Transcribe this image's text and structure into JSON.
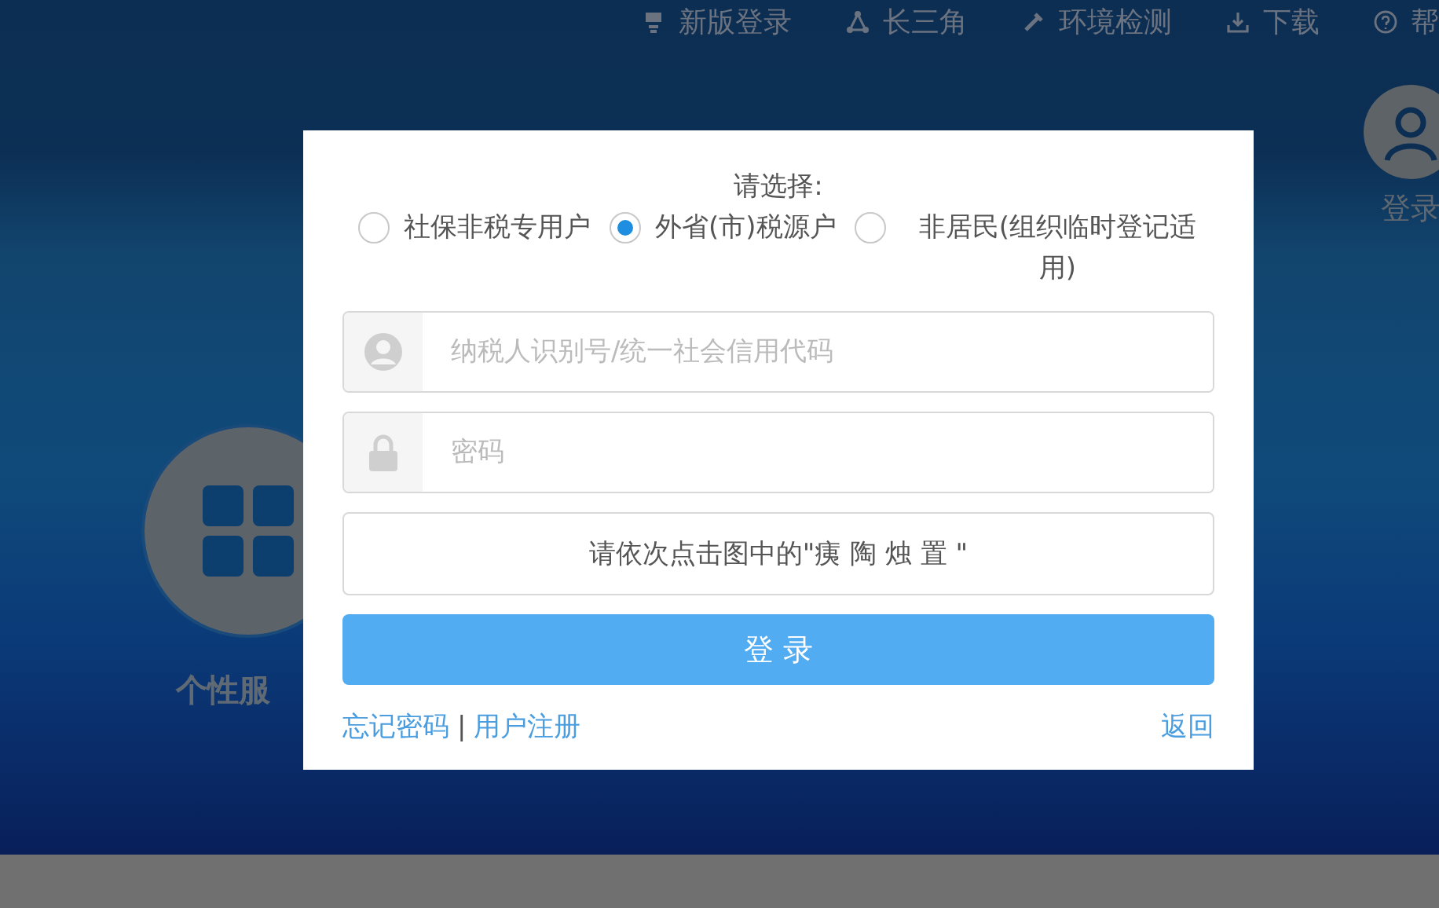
{
  "nav": [
    {
      "label": "新版登录"
    },
    {
      "label": "长三角"
    },
    {
      "label": "环境检测"
    },
    {
      "label": "下载"
    },
    {
      "label": "帮"
    }
  ],
  "side_left": {
    "label": "个性服"
  },
  "side_right": {
    "label": "登录"
  },
  "dialog": {
    "prompt": "请选择:",
    "options": [
      {
        "label": "社保非税专用户",
        "selected": false
      },
      {
        "label": "外省(市)税源户",
        "selected": true
      },
      {
        "label": "非居民(组织临时登记适用)",
        "selected": false
      }
    ],
    "fields": [
      {
        "kind": "user",
        "placeholder": "纳税人识别号/统一社会信用代码"
      },
      {
        "kind": "lock",
        "placeholder": "密码"
      }
    ],
    "captcha": "请依次点击图中的\"痍 陶 烛 置 \"",
    "submit": "登 录",
    "links": [
      "忘记密码",
      "用户注册"
    ],
    "separator": "|",
    "back": "返回"
  }
}
